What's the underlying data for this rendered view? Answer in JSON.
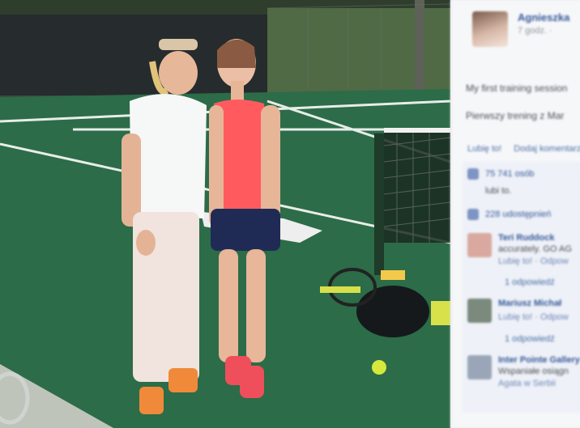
{
  "photo": {
    "alt": "Two women posing on a tennis court"
  },
  "post": {
    "author": "Agnieszka",
    "time": "7 godz. ·",
    "text_en": "My first training session",
    "text_pl": "Pierwszy trening z Mar",
    "actions": [
      "Lubię to!",
      "Dodaj komentarz"
    ]
  },
  "likes": {
    "count_text": "75 741 osób",
    "count_suffix": "lubi to.",
    "shares_text": "228 udostępnień"
  },
  "comments": [
    {
      "name": "Teri Ruddock",
      "text": "accurately. GO AG",
      "links": "Lubię to! · Odpow"
    },
    {
      "name": "Mariusz Michał",
      "text": "",
      "links": "Lubię to! · Odpow"
    },
    {
      "name": "Inter Pointe Gallery",
      "text": "Wspaniałe osiągn",
      "links": "Agata w Serbii"
    }
  ],
  "replies": [
    "1 odpowiedź",
    "1 odpowiedź"
  ],
  "colors": {
    "court": "#2a6b47",
    "link": "#365899"
  }
}
